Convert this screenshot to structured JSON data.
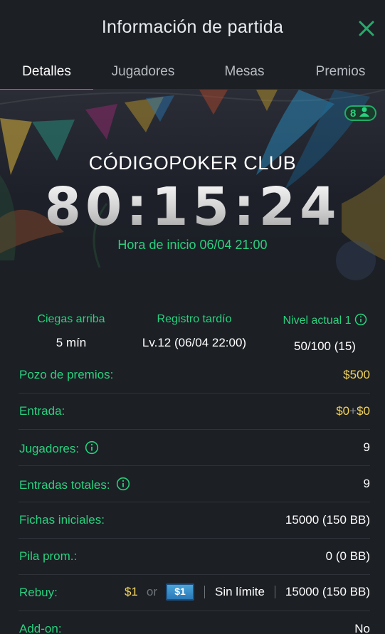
{
  "header": {
    "title": "Información de partida",
    "close_icon": "close-icon"
  },
  "tabs": [
    {
      "label": "Detalles",
      "active": true
    },
    {
      "label": "Jugadores",
      "active": false
    },
    {
      "label": "Mesas",
      "active": false
    },
    {
      "label": "Premios",
      "active": false
    }
  ],
  "banner": {
    "player_count": "8",
    "club_name": "CÓDIGOPOKER CLUB",
    "countdown": "80:15:24",
    "start_time": "Hora de inicio 06/04 21:00"
  },
  "stats": [
    {
      "label": "Ciegas arriba",
      "value": "5 mín"
    },
    {
      "label": "Registro tardío",
      "value": "Lv.12 (06/04 22:00)"
    },
    {
      "label": "Nivel actual 1",
      "value": "50/100 (15)"
    }
  ],
  "rows": {
    "prize_pool": {
      "label": "Pozo de premios:",
      "value": "$500"
    },
    "entry": {
      "label": "Entrada:",
      "value_a": "$0",
      "plus": "+",
      "value_b": "$0"
    },
    "players": {
      "label": "Jugadores:",
      "value": "9"
    },
    "total_entries": {
      "label": "Entradas totales:",
      "value": "9"
    },
    "starting_chips": {
      "label": "Fichas iniciales:",
      "value": "15000 (150 BB)"
    },
    "avg_stack": {
      "label": "Pila prom.:",
      "value": "0 (0 BB)"
    },
    "rebuy": {
      "label": "Rebuy:",
      "price": "$1",
      "or": "or",
      "ticket": "$1",
      "limit": "Sin límite",
      "chips": "15000 (150 BB)"
    },
    "addon": {
      "label": "Add-on:",
      "value": "No"
    }
  },
  "colors": {
    "accent": "#2ad17f",
    "gold": "#f2d35c",
    "background": "#1c1f24"
  }
}
